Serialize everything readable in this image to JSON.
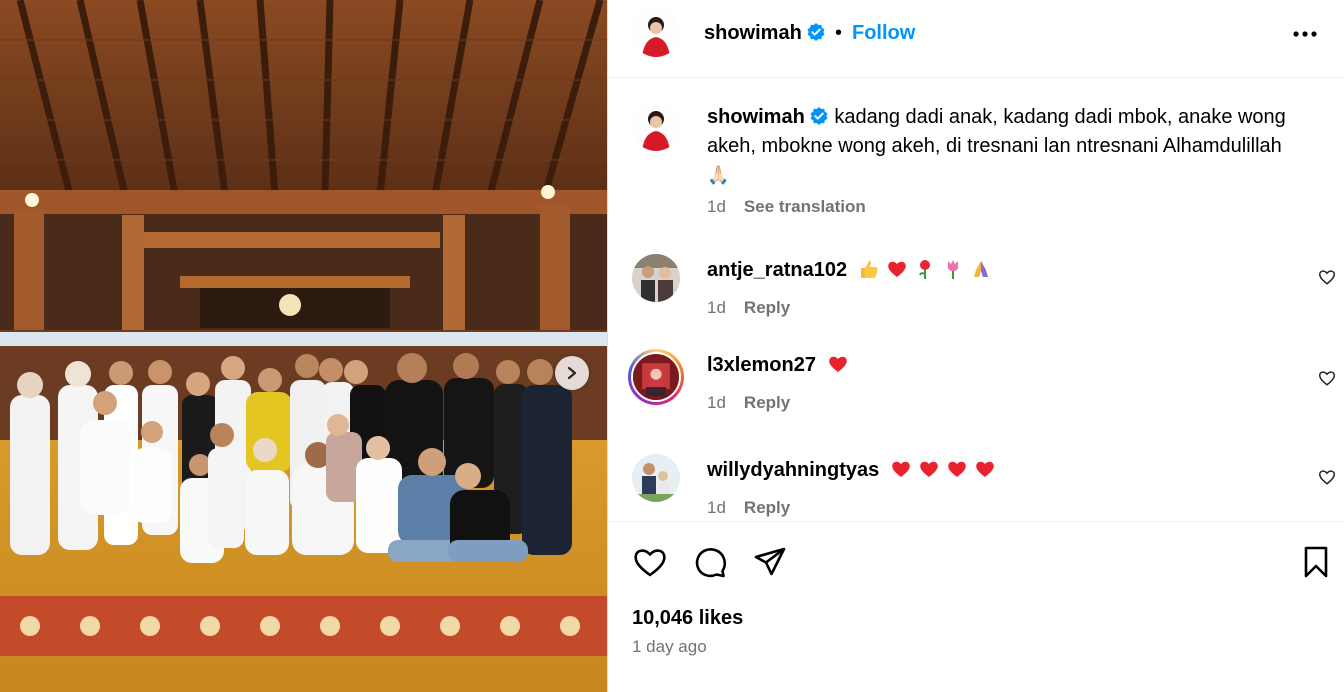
{
  "post": {
    "username": "showimah",
    "follow_label": "Follow",
    "separator": "•"
  },
  "caption": {
    "username": "showimah",
    "text": "kadang dadi anak, kadang dadi mbok, anake wong akeh, mbokne wong akeh, di tresnani lan ntresnani Alhamdulillah",
    "emoji": "🙏🏻",
    "age": "1d",
    "see_translation": "See translation"
  },
  "comments": [
    {
      "username": "antje_ratna102",
      "text": "👍❤️🌹🌷🙏",
      "age": "1d",
      "reply": "Reply"
    },
    {
      "username": "l3xlemon27",
      "text": "❤️",
      "age": "1d",
      "reply": "Reply"
    },
    {
      "username": "willydyahningtyas",
      "text": "❤️❤️❤️❤️",
      "age": "1d",
      "reply": "Reply"
    }
  ],
  "stats": {
    "likes": "10,046 likes",
    "posted": "1 day ago"
  },
  "icons": {
    "like": "heart-icon",
    "comment": "comment-icon",
    "share": "paper-plane-icon",
    "save": "bookmark-icon",
    "more": "more-options-icon",
    "next": "chevron-right-icon",
    "verified": "verified-badge-icon"
  },
  "colors": {
    "accent": "#0095f6",
    "secondary_text": "#737373",
    "heart_red": "#ff3040"
  }
}
